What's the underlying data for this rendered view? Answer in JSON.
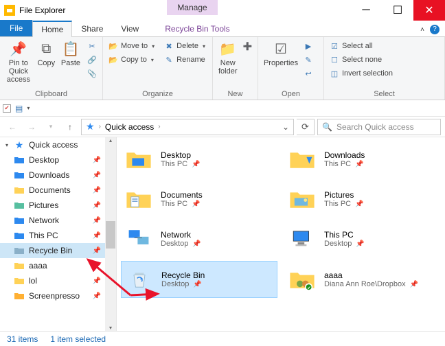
{
  "title": "File Explorer",
  "manage_tab": "Manage",
  "tabs": {
    "file": "File",
    "home": "Home",
    "share": "Share",
    "view": "View",
    "tool": "Recycle Bin Tools"
  },
  "ribbon": {
    "clipboard": {
      "label": "Clipboard",
      "pin": "Pin to Quick access",
      "copy": "Copy",
      "paste": "Paste"
    },
    "organize": {
      "label": "Organize",
      "moveto": "Move to",
      "copyto": "Copy to",
      "delete": "Delete",
      "rename": "Rename"
    },
    "new": {
      "label": "New",
      "folder": "New folder"
    },
    "open": {
      "label": "Open",
      "properties": "Properties"
    },
    "select": {
      "label": "Select",
      "all": "Select all",
      "none": "Select none",
      "invert": "Invert selection"
    }
  },
  "address": {
    "root": "Quick access",
    "search_placeholder": "Search Quick access"
  },
  "sidebar": {
    "root": "Quick access",
    "items": [
      {
        "label": "Desktop",
        "pin": true
      },
      {
        "label": "Downloads",
        "pin": true
      },
      {
        "label": "Documents",
        "pin": true
      },
      {
        "label": "Pictures",
        "pin": true
      },
      {
        "label": "Network",
        "pin": true
      },
      {
        "label": "This PC",
        "pin": true
      },
      {
        "label": "Recycle Bin",
        "pin": true,
        "selected": true
      },
      {
        "label": "aaaa",
        "pin": true
      },
      {
        "label": "lol",
        "pin": true
      },
      {
        "label": "Screenpresso",
        "pin": true
      }
    ]
  },
  "items": [
    {
      "name": "Desktop",
      "sub": "This PC",
      "icon": "folder-blue"
    },
    {
      "name": "Downloads",
      "sub": "This PC",
      "icon": "folder-down"
    },
    {
      "name": "Documents",
      "sub": "This PC",
      "icon": "folder-doc"
    },
    {
      "name": "Pictures",
      "sub": "This PC",
      "icon": "folder-pic"
    },
    {
      "name": "Network",
      "sub": "Desktop",
      "icon": "network"
    },
    {
      "name": "This PC",
      "sub": "Desktop",
      "icon": "pc"
    },
    {
      "name": "Recycle Bin",
      "sub": "Desktop",
      "icon": "recycle",
      "selected": true
    },
    {
      "name": "aaaa",
      "sub": "Diana Ann Roe\\Dropbox",
      "icon": "folder-shared"
    }
  ],
  "status": {
    "count": "31 items",
    "selected": "1 item selected"
  }
}
